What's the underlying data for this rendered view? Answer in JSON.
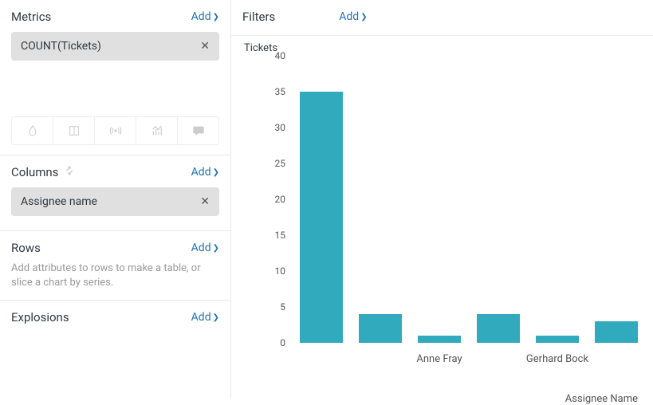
{
  "sidebar": {
    "metrics": {
      "title": "Metrics",
      "add": "Add",
      "items": [
        {
          "label": "COUNT(Tickets)"
        }
      ]
    },
    "columns": {
      "title": "Columns",
      "add": "Add",
      "items": [
        {
          "label": "Assignee name"
        }
      ]
    },
    "rows": {
      "title": "Rows",
      "add": "Add",
      "hint": "Add attributes to rows to make a table, or slice a chart by series."
    },
    "explosions": {
      "title": "Explosions",
      "add": "Add"
    }
  },
  "filters": {
    "title": "Filters",
    "add": "Add"
  },
  "chart_data": {
    "type": "bar",
    "title": "Tickets",
    "ylabel": "",
    "xlabel": "Assignee Name",
    "ylim": [
      0,
      40
    ],
    "yticks": [
      0,
      5,
      10,
      15,
      20,
      25,
      30,
      35,
      40
    ],
    "categories": [
      "",
      "",
      "Anne Fray",
      "",
      "Gerhard Bock",
      ""
    ],
    "values": [
      35,
      4,
      1,
      4,
      1,
      3
    ]
  }
}
